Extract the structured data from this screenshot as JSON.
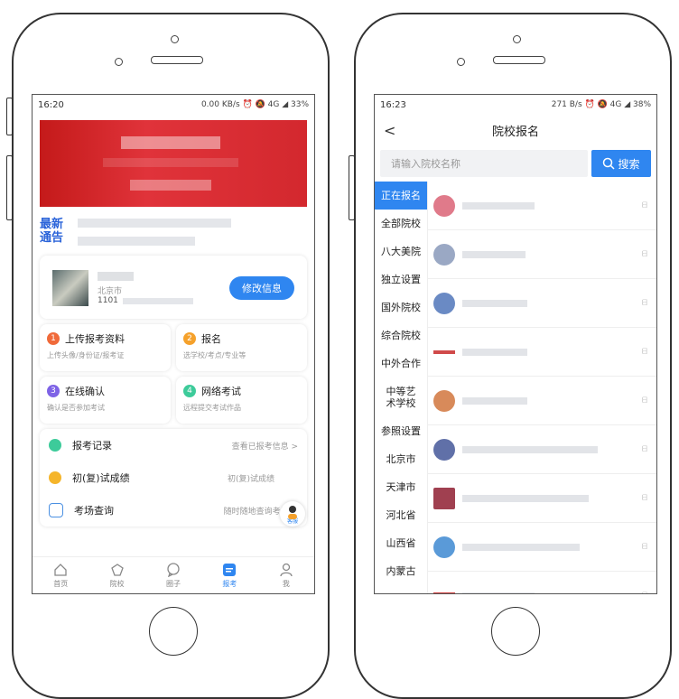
{
  "left": {
    "status": {
      "time": "16:20",
      "indicators": "0.00 KB/s ⏰ 🔕 4G ◢ 33%"
    },
    "notice": {
      "tag_line1": "最新",
      "tag_line2": "通告"
    },
    "profile": {
      "city": "北京市",
      "id_prefix": "1101",
      "edit_button": "修改信息"
    },
    "steps": [
      {
        "num": "1",
        "title": "上传报考资料",
        "sub": "上传头像/身份证/报考证",
        "color": "#f06a3a"
      },
      {
        "num": "2",
        "title": "报名",
        "sub": "选学校/考点/专业等",
        "color": "#f5a12b"
      },
      {
        "num": "3",
        "title": "在线确认",
        "sub": "确认是否参加考试",
        "color": "#7e63e6"
      },
      {
        "num": "4",
        "title": "网络考试",
        "sub": "远程提交考试作品",
        "color": "#3dcb9a"
      }
    ],
    "list": [
      {
        "label": "报考记录",
        "right": "查看已报考信息 >",
        "color": "#3dcb9a"
      },
      {
        "label": "初(复)试成绩",
        "right": "初(复)试成绩",
        "color": "#f5b52b"
      },
      {
        "label": "考场查询",
        "right": "随时随地查询考场 >",
        "color": "#4a90e2"
      }
    ],
    "cs_label": "客服",
    "tabs": [
      {
        "label": "首页",
        "active": false
      },
      {
        "label": "院校",
        "active": false
      },
      {
        "label": "圈子",
        "active": false
      },
      {
        "label": "报考",
        "active": true
      },
      {
        "label": "我",
        "active": false
      }
    ]
  },
  "right": {
    "status": {
      "time": "16:23",
      "indicators": "271 B/s ⏰ 🔕 4G ◢ 38%"
    },
    "title": "院校报名",
    "back": "<",
    "search_placeholder": "请输入院校名称",
    "search_button": "搜索",
    "categories": [
      {
        "label": "正在报名",
        "selected": true
      },
      {
        "label": "全部院校"
      },
      {
        "label": "八大美院"
      },
      {
        "label": "独立设置"
      },
      {
        "label": "国外院校"
      },
      {
        "label": "综合院校"
      },
      {
        "label": "中外合作"
      },
      {
        "label": "中等艺术学校",
        "tall": true
      },
      {
        "label": "参照设置"
      },
      {
        "label": "北京市"
      },
      {
        "label": "天津市"
      },
      {
        "label": "河北省"
      },
      {
        "label": "山西省"
      },
      {
        "label": "内蒙古"
      }
    ],
    "school_badge": "ᗺ",
    "school_logo_colors": [
      "#e07a8a",
      "#9aa8c4",
      "#6a8ac4",
      "#d04a4a",
      "#d88a5a",
      "#6070a8",
      "#a04050",
      "#5a9ad8",
      "#d04040"
    ]
  }
}
